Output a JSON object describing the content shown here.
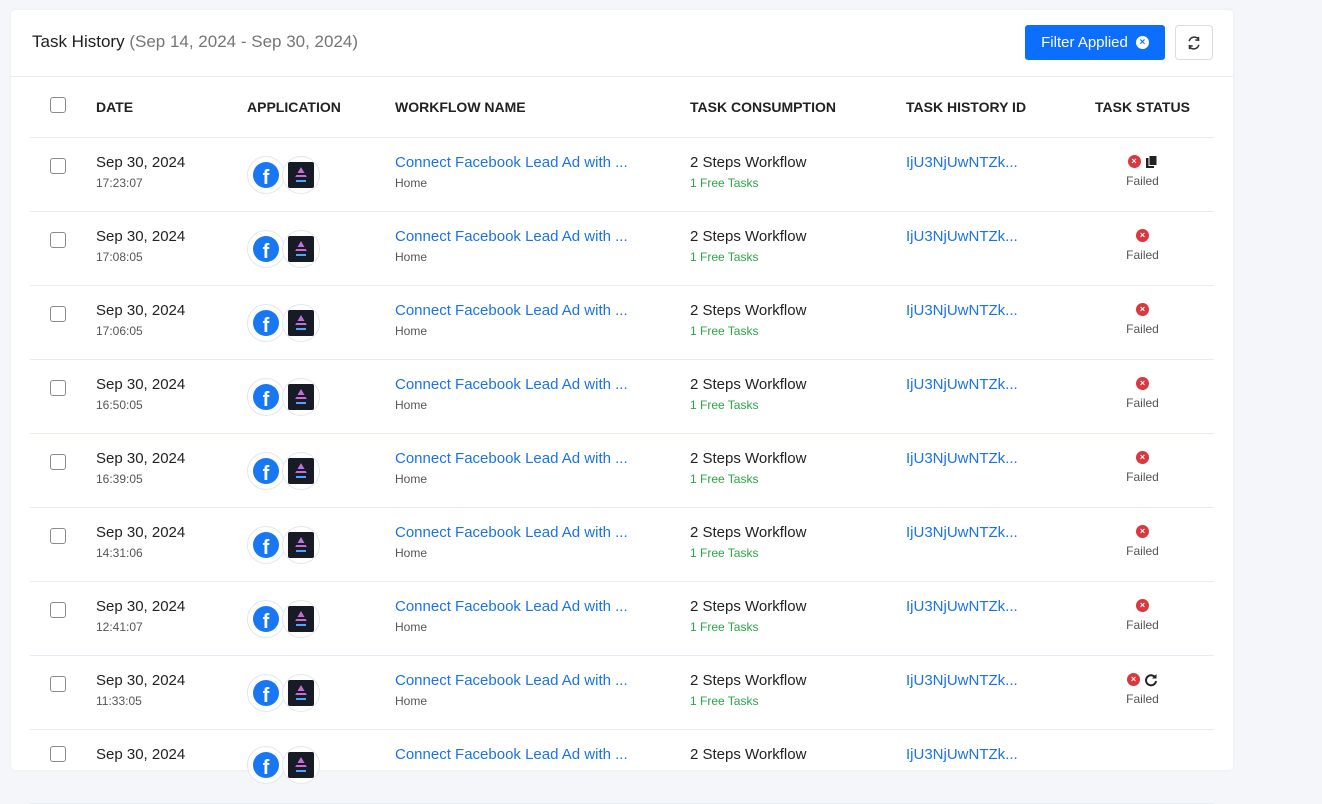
{
  "header": {
    "title": "Task History",
    "date_range": "(Sep 14, 2024 - Sep 30, 2024)",
    "filter_label": "Filter Applied",
    "refresh_icon": "refresh-icon"
  },
  "table": {
    "columns": {
      "date": "DATE",
      "application": "APPLICATION",
      "workflow_name": "WORKFLOW NAME",
      "task_consumption": "TASK CONSUMPTION",
      "task_history_id": "TASK HISTORY ID",
      "task_status": "TASK STATUS"
    },
    "rows": [
      {
        "date": "Sep 30, 2024",
        "time": "17:23:07",
        "workflow": "Connect Facebook Lead Ad with ...",
        "folder": "Home",
        "consumption": "2 Steps Workflow",
        "tasks": "1 Free Tasks",
        "id": "IjU3NjUwNTZk...",
        "status": "Failed",
        "extra_icon": "copy-icon"
      },
      {
        "date": "Sep 30, 2024",
        "time": "17:08:05",
        "workflow": "Connect Facebook Lead Ad with ...",
        "folder": "Home",
        "consumption": "2 Steps Workflow",
        "tasks": "1 Free Tasks",
        "id": "IjU3NjUwNTZk...",
        "status": "Failed",
        "extra_icon": ""
      },
      {
        "date": "Sep 30, 2024",
        "time": "17:06:05",
        "workflow": "Connect Facebook Lead Ad with ...",
        "folder": "Home",
        "consumption": "2 Steps Workflow",
        "tasks": "1 Free Tasks",
        "id": "IjU3NjUwNTZk...",
        "status": "Failed",
        "extra_icon": ""
      },
      {
        "date": "Sep 30, 2024",
        "time": "16:50:05",
        "workflow": "Connect Facebook Lead Ad with ...",
        "folder": "Home",
        "consumption": "2 Steps Workflow",
        "tasks": "1 Free Tasks",
        "id": "IjU3NjUwNTZk...",
        "status": "Failed",
        "extra_icon": ""
      },
      {
        "date": "Sep 30, 2024",
        "time": "16:39:05",
        "workflow": "Connect Facebook Lead Ad with ...",
        "folder": "Home",
        "consumption": "2 Steps Workflow",
        "tasks": "1 Free Tasks",
        "id": "IjU3NjUwNTZk...",
        "status": "Failed",
        "extra_icon": ""
      },
      {
        "date": "Sep 30, 2024",
        "time": "14:31:06",
        "workflow": "Connect Facebook Lead Ad with ...",
        "folder": "Home",
        "consumption": "2 Steps Workflow",
        "tasks": "1 Free Tasks",
        "id": "IjU3NjUwNTZk...",
        "status": "Failed",
        "extra_icon": ""
      },
      {
        "date": "Sep 30, 2024",
        "time": "12:41:07",
        "workflow": "Connect Facebook Lead Ad with ...",
        "folder": "Home",
        "consumption": "2 Steps Workflow",
        "tasks": "1 Free Tasks",
        "id": "IjU3NjUwNTZk...",
        "status": "Failed",
        "extra_icon": ""
      },
      {
        "date": "Sep 30, 2024",
        "time": "11:33:05",
        "workflow": "Connect Facebook Lead Ad with ...",
        "folder": "Home",
        "consumption": "2 Steps Workflow",
        "tasks": "1 Free Tasks",
        "id": "IjU3NjUwNTZk...",
        "status": "Failed",
        "extra_icon": "retry-icon"
      },
      {
        "date": "Sep 30, 2024",
        "time": "",
        "workflow": "Connect Facebook Lead Ad with ...",
        "folder": "",
        "consumption": "2 Steps Workflow",
        "tasks": "",
        "id": "IjU3NjUwNTZk...",
        "status": "",
        "extra_icon": ""
      }
    ]
  },
  "colors": {
    "accent": "#0b6efd",
    "link": "#1a73e8",
    "failed": "#d9383f",
    "free_tasks": "#27a844"
  }
}
